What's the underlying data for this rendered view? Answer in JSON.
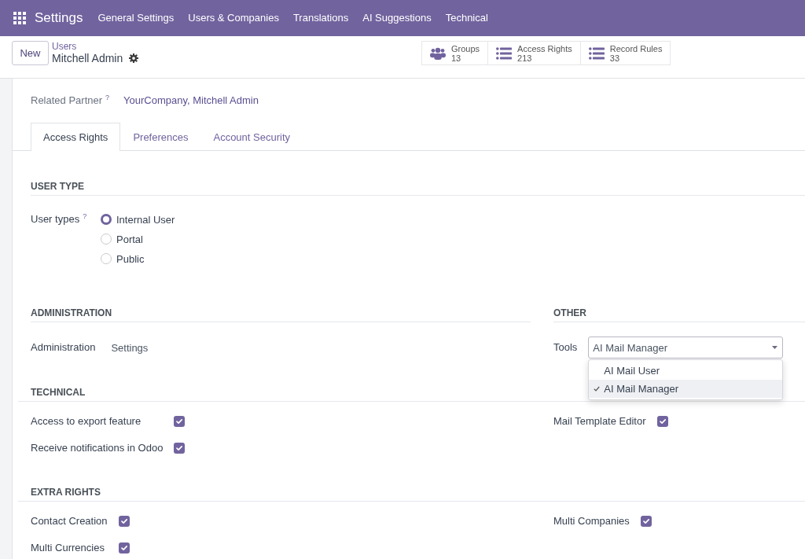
{
  "navbar": {
    "app_name": "Settings",
    "menu": [
      "General Settings",
      "Users & Companies",
      "Translations",
      "AI Suggestions",
      "Technical"
    ]
  },
  "control_panel": {
    "new_button": "New",
    "breadcrumb": {
      "parent": "Users",
      "current": "Mitchell Admin"
    },
    "smart_buttons": [
      {
        "kind": "group",
        "label": "Groups",
        "count": "13"
      },
      {
        "kind": "list",
        "label": "Access Rights",
        "count": "213"
      },
      {
        "kind": "list",
        "label": "Record Rules",
        "count": "33"
      }
    ]
  },
  "form": {
    "related_partner": {
      "label": "Related Partner",
      "help": "?",
      "value": "YourCompany, Mitchell Admin"
    },
    "tabs": [
      {
        "label": "Access Rights",
        "selected": true
      },
      {
        "label": "Preferences",
        "selected": false
      },
      {
        "label": "Account Security",
        "selected": false
      }
    ],
    "user_type": {
      "title": "USER TYPE",
      "label": "User types",
      "help": "?",
      "options": [
        {
          "label": "Internal User",
          "selected": true
        },
        {
          "label": "Portal",
          "selected": false
        },
        {
          "label": "Public",
          "selected": false
        }
      ]
    },
    "app_groups": [
      {
        "title": "ADMINISTRATION",
        "label": "Administration",
        "value": "Settings",
        "expanded": false
      },
      {
        "title": "OTHER",
        "label": "Tools",
        "value": "AI Mail Manager",
        "expanded": true,
        "options": [
          {
            "label": "AI Mail User",
            "selected": false
          },
          {
            "label": "AI Mail Manager",
            "selected": true
          }
        ]
      }
    ],
    "checkbox_sections": [
      {
        "title": "TECHNICAL",
        "left": [
          {
            "label": "Access to export feature",
            "checked": true
          },
          {
            "label": "Receive notifications in Odoo",
            "checked": true
          }
        ],
        "right": [
          {
            "label": "Mail Template Editor",
            "checked": true
          }
        ]
      },
      {
        "title": "EXTRA RIGHTS",
        "left": [
          {
            "label": "Contact Creation",
            "checked": true
          },
          {
            "label": "Multi Currencies",
            "checked": true
          }
        ],
        "right": [
          {
            "label": "Multi Companies",
            "checked": true
          }
        ]
      }
    ]
  }
}
